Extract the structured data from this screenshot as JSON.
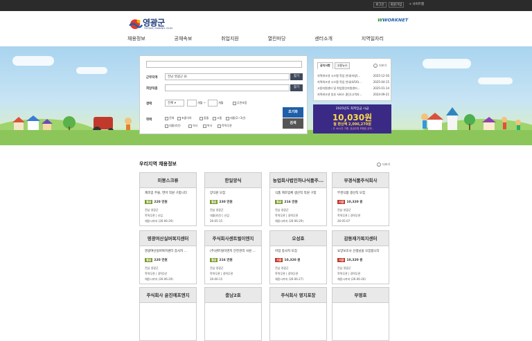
{
  "topbar": {
    "login": "로그인",
    "join": "회원가입",
    "sitemap": "+ 사이트맵"
  },
  "logo": {
    "name": "영광군",
    "english": "YEONG GWANG-GUN"
  },
  "worknet": {
    "part1": "W",
    "part2": "WORKNET"
  },
  "nav": [
    "채용정보",
    "공채속보",
    "취업지원",
    "열린마당",
    "센터소개",
    "지역일자리"
  ],
  "search": {
    "region_label": "근무지역",
    "region_value": "전남 영광군 ☒",
    "find_label": "찾기",
    "job_label": "희망직종",
    "career_label": "경력",
    "career_value": "전체",
    "months_suffix_1": "개월 ~",
    "months_suffix_2": "개월",
    "career_none": "무관포함",
    "edu_label": "학력",
    "edu_options": [
      "전체",
      "초졸이하",
      "중졸",
      "고졸",
      "대졸(2~3년)",
      "대졸(4년)",
      "석사",
      "박사",
      "학력무관"
    ],
    "reset_label": "초기화",
    "search_label": "검색"
  },
  "notice": {
    "tabs": [
      "공지사항",
      "고용뉴스"
    ],
    "more": "더보기",
    "items": [
      {
        "title": "지역워크넷 시스템 작업 안내(지방)...",
        "date": "2025-12-30"
      },
      {
        "title": "지역워크넷 시스템 작업 안내(4/16)...",
        "date": "2025-04-15"
      },
      {
        "title": "고용지원센터 및 취업알선지원센터...",
        "date": "2025-01-14"
      },
      {
        "title": "지역워크넷 일부 서비스 중단(고객지...",
        "date": "2024-09-21"
      }
    ]
  },
  "banner": {
    "line1": "2025년도 최저임금 시급",
    "amount": "10,030원",
    "monthly": "월 환산액 2,096,270원",
    "note": "- 주 40시간 기준, 유급주휴 포함된 금액 -"
  },
  "section": {
    "title": "우리지역 채용정보",
    "more": "더보기"
  },
  "colors": {
    "hire_badge": "#7a9a2e",
    "hour_badge": "#c0392b",
    "search_btn": "#1f5fa8",
    "search2_btn": "#555555"
  },
  "jobs": [
    {
      "company": "미봉스크류",
      "title": "제조업 주물, 연마 직원 구합니다",
      "pay_type": "월급",
      "pay": "220 만원",
      "pay_color": "#7a9a2e",
      "region": "전남 영광군",
      "edu": "학력무관 | 신입",
      "deadline": "채용시까지 (26-06-29)"
    },
    {
      "company": "한일양식",
      "title": "양식원 모집",
      "pay_type": "월급",
      "pay": "230 만원",
      "pay_color": "#7a9a2e",
      "region": "전남 영광군",
      "edu": "대졸(4년) | 신입",
      "deadline": "26-05-15"
    },
    {
      "company": "농업회사법인하나식품주...",
      "title": "식품 제조업체 생산직 직원 구함",
      "pay_type": "월급",
      "pay": "216 만원",
      "pay_color": "#7a9a2e",
      "region": "전남 영광군",
      "edu": "학력무관 | 경력무관",
      "deadline": "채용시까지 (26-06-29)"
    },
    {
      "company": "부경식품주식회사",
      "title": "부경식품 생산직 모집",
      "pay_type": "시급",
      "pay": "10,320 원",
      "pay_color": "#c0392b",
      "region": "전남 영광군",
      "edu": "학력무관 | 경력무관",
      "deadline": "26-05-07"
    },
    {
      "company": "영광여산실버복지센터",
      "title": "영광여산실버복지센터 증사자 ...",
      "pay_type": "월급",
      "pay": "220 만원",
      "pay_color": "#7a9a2e",
      "region": "전남 영광군",
      "edu": "학력무관 | 경력1년",
      "deadline": "채용시까지 (26-06-29)"
    },
    {
      "company": "주식회사센트럴이엔지",
      "title": "(주)센트럴이엔지 안전관리 사원 ...",
      "pay_type": "월급",
      "pay": "216 만원",
      "pay_color": "#7a9a2e",
      "region": "전남 영광군",
      "edu": "학력무관 | 경력무관",
      "deadline": "26-06-15"
    },
    {
      "company": "오성호",
      "title": "어업 종사자 모집",
      "pay_type": "시급",
      "pay": "10,320 원",
      "pay_color": "#c0392b",
      "region": "전남 영광군",
      "edu": "학력무관 | 경력무관",
      "deadline": "채용시까지 (26-06-27)"
    },
    {
      "company": "감동재가복지센터",
      "title": "요양보호사 선생님을 모집합니다",
      "pay_type": "시급",
      "pay": "10,320 원",
      "pay_color": "#c0392b",
      "region": "전남 영광군",
      "edu": "학력무관 | 경력무관",
      "deadline": "채용시까지 (26-06-26)"
    },
    {
      "company": "주식회사 윤진에프엔지"
    },
    {
      "company": "충남2호"
    },
    {
      "company": "주식회사 영지포장"
    },
    {
      "company": "부영호"
    }
  ]
}
